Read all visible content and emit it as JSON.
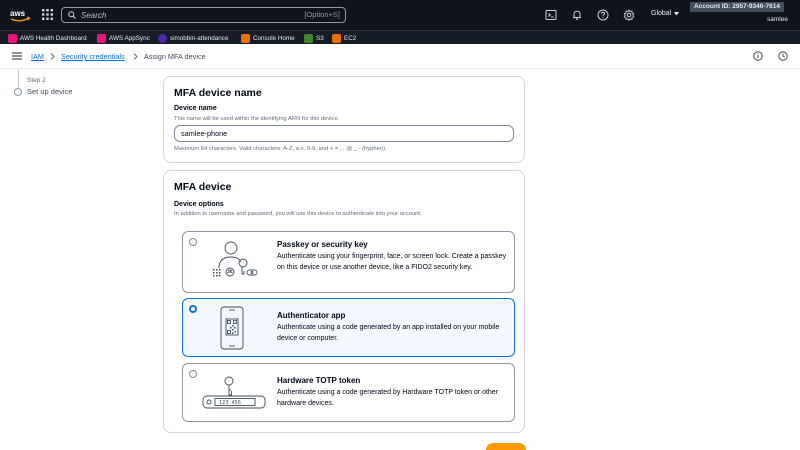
{
  "topnav": {
    "search_placeholder": "Search",
    "search_shortcut": "[Option+S]",
    "region": "Global",
    "account_id": "Account ID: 2957-9346-7614",
    "user": "samlee"
  },
  "favorites": [
    {
      "label": "AWS Health Dashboard",
      "color": "#e7157b"
    },
    {
      "label": "AWS AppSync",
      "color": "#e7157b"
    },
    {
      "label": "simobbin-attendance",
      "color": "#4d27aa"
    },
    {
      "label": "Console Home",
      "color": "#ed7100"
    },
    {
      "label": "S3",
      "color": "#3f8624"
    },
    {
      "label": "EC2",
      "color": "#ed7100"
    }
  ],
  "breadcrumb": {
    "items": [
      "IAM",
      "Security credentials"
    ],
    "current": "Assign MFA device"
  },
  "steps": {
    "step_number": "Step 2",
    "step_label": "Set up device"
  },
  "device_name_card": {
    "title": "MFA device name",
    "label": "Device name",
    "description": "This name will be used within the identifying ARN for this device.",
    "value": "samlee-phone",
    "constraint": "Maximum 64 characters. Valid characters: A-Z, a-z, 0-9, and + = , . @ _ - (hyphen)"
  },
  "mfa_device_card": {
    "title": "MFA device",
    "label": "Device options",
    "description": "In addition to username and password, you will use this device to authenticate into your account.",
    "options": [
      {
        "title": "Passkey or security key",
        "desc": "Authenticate using your fingerprint, face, or screen lock. Create a passkey on this device or use another device, like a FIDO2 security key.",
        "selected": false
      },
      {
        "title": "Authenticator app",
        "desc": "Authenticate using a code generated by an app installed on your mobile device or computer.",
        "selected": true
      },
      {
        "title": "Hardware TOTP token",
        "desc": "Authenticate using a code generated by Hardware TOTP token or other hardware devices.",
        "selected": false
      }
    ]
  },
  "colors": {
    "accent": "#0972d3",
    "primary_button": "#ff9900",
    "nav_bg": "#0f141a"
  }
}
